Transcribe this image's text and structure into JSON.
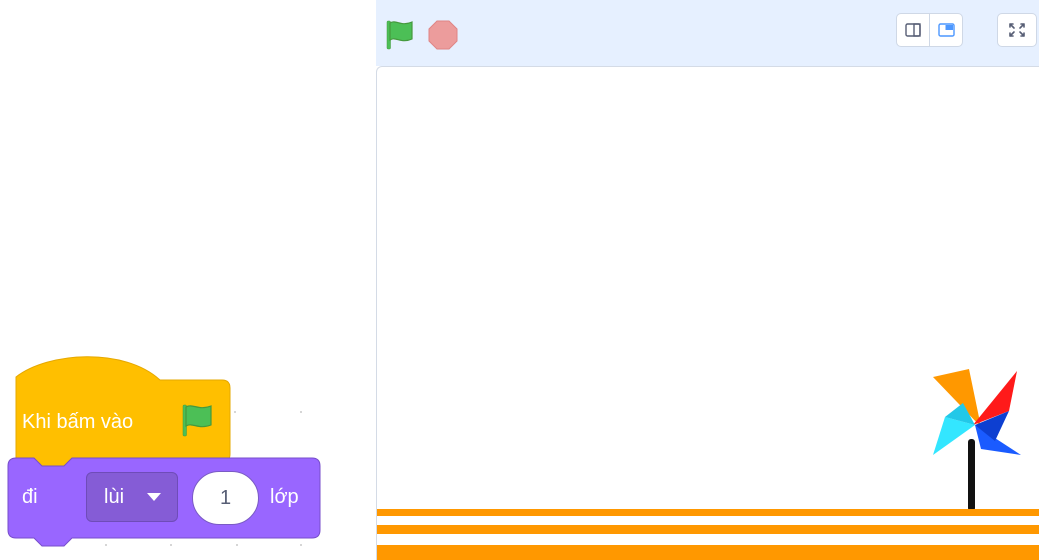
{
  "code_area": {
    "hat_block": {
      "label": "Khi bấm vào",
      "icon": "green-flag-icon",
      "color": "#ffbf00"
    },
    "motion_block": {
      "label": "đi",
      "dropdown_value": "lùi",
      "number_value": "1",
      "suffix": "lớp",
      "color": "#9966ff"
    }
  },
  "stage_header": {
    "green_flag_icon": "green-flag-icon",
    "stop_icon": "stop-icon",
    "small_stage_icon": "small-stage-icon",
    "normal_stage_icon": "normal-stage-icon",
    "fullscreen_icon": "fullscreen-icon",
    "background_color": "#e6f0ff"
  },
  "stage": {
    "sprite": "pinwheel",
    "ground_color": "#ff9800"
  }
}
